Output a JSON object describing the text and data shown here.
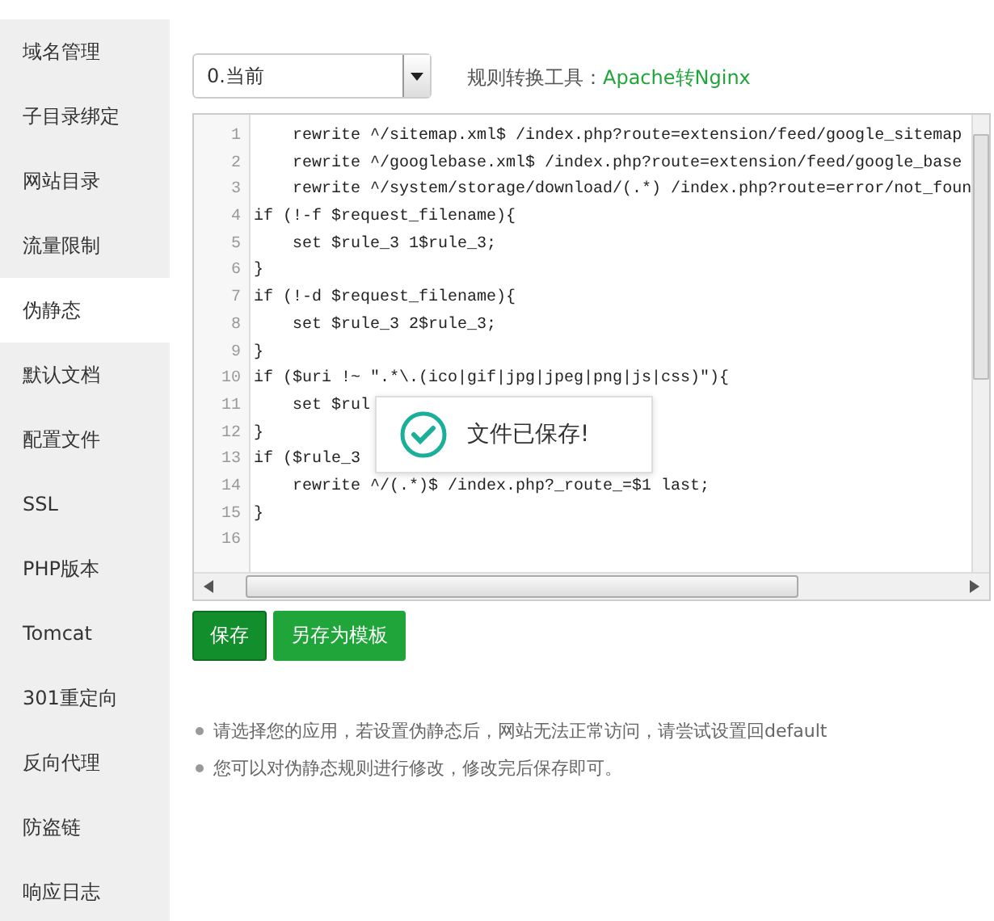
{
  "sidebar": {
    "items": [
      {
        "label": "域名管理",
        "selected": false
      },
      {
        "label": "子目录绑定",
        "selected": false
      },
      {
        "label": "网站目录",
        "selected": false
      },
      {
        "label": "流量限制",
        "selected": false
      },
      {
        "label": "伪静态",
        "selected": true
      },
      {
        "label": "默认文档",
        "selected": false
      },
      {
        "label": "配置文件",
        "selected": false
      },
      {
        "label": "SSL",
        "selected": false
      },
      {
        "label": "PHP版本",
        "selected": false
      },
      {
        "label": "Tomcat",
        "selected": false
      },
      {
        "label": "301重定向",
        "selected": false
      },
      {
        "label": "反向代理",
        "selected": false
      },
      {
        "label": "防盗链",
        "selected": false
      },
      {
        "label": "响应日志",
        "selected": false
      }
    ]
  },
  "version_select": {
    "value": "0.当前"
  },
  "converter": {
    "label": "规则转换工具：",
    "link": "Apache转Nginx"
  },
  "editor": {
    "lines": [
      {
        "number": "1",
        "text": "    rewrite ^/sitemap.xml$ /index.php?route=extension/feed/google_sitemap"
      },
      {
        "number": "2",
        "text": "    rewrite ^/googlebase.xml$ /index.php?route=extension/feed/google_base"
      },
      {
        "number": "3",
        "text": "    rewrite ^/system/storage/download/(.*) /index.php?route=error/not_foun"
      },
      {
        "number": "4",
        "text": "if (!-f $request_filename){"
      },
      {
        "number": "5",
        "text": "    set $rule_3 1$rule_3;"
      },
      {
        "number": "6",
        "text": "}"
      },
      {
        "number": "7",
        "text": "if (!-d $request_filename){"
      },
      {
        "number": "8",
        "text": "    set $rule_3 2$rule_3;"
      },
      {
        "number": "9",
        "text": "}"
      },
      {
        "number": "10",
        "text": "if ($uri !~ \".*\\.(ico|gif|jpg|jpeg|png|js|css)\"){"
      },
      {
        "number": "11",
        "text": "    set $rul"
      },
      {
        "number": "12",
        "text": "}"
      },
      {
        "number": "13",
        "text": "if ($rule_3"
      },
      {
        "number": "14",
        "text": "    rewrite ^/(.*)$ /index.php?_route_=$1 last;"
      },
      {
        "number": "15",
        "text": "}"
      },
      {
        "number": "16"
      }
    ]
  },
  "toast": {
    "message": "文件已保存!"
  },
  "buttons": [
    {
      "label": "保存",
      "kind": "primary"
    },
    {
      "label": "另存为模板",
      "kind": "secondary"
    }
  ],
  "notes": [
    "请选择您的应用，若设置伪静态后，网站无法正常访问，请尝试设置回default",
    "您可以对伪静态规则进行修改，修改完后保存即可。"
  ]
}
